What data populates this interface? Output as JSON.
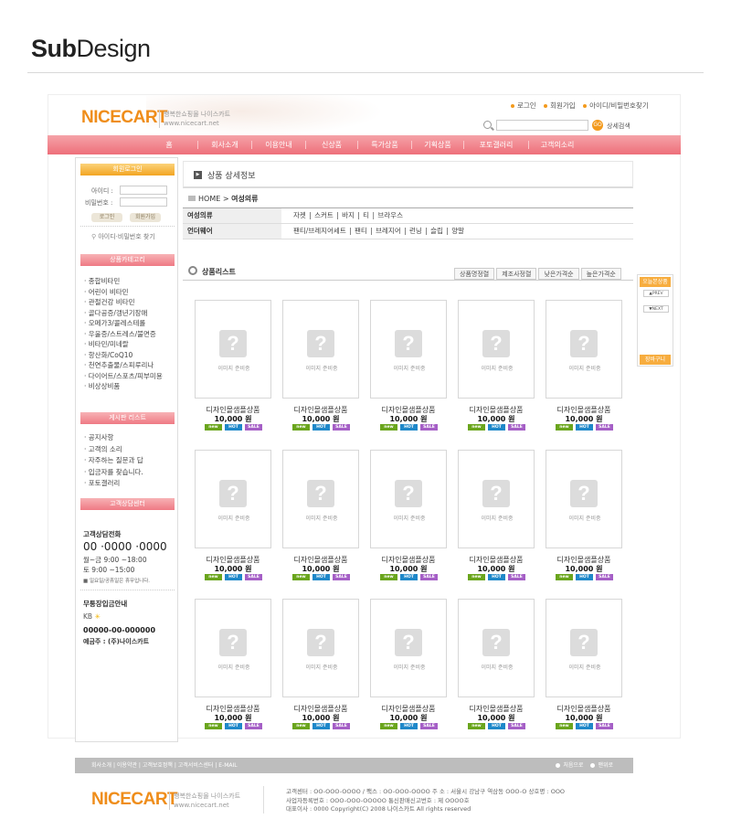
{
  "heading": {
    "bold": "Sub",
    "normal": "Design"
  },
  "header": {
    "logo": "NICECART",
    "logo_tagline": "행복한쇼핑몰 나이스카트",
    "logo_url": "www.nicecart.net",
    "top_links": [
      "로그인",
      "회원가입",
      "아이디/비밀번호찾기"
    ],
    "search_go": "GO",
    "search_detail": "상세검색"
  },
  "nav": [
    "홈",
    "회사소개",
    "이용안내",
    "신상품",
    "특가상품",
    "기획상품",
    "포토갤러리",
    "고객의소리"
  ],
  "sidebar": {
    "login_title": "회원로그인",
    "id_label": "아이디 :",
    "pw_label": "비밀번호 :",
    "login_btn": "로그인",
    "join_btn": "회원가입",
    "find_link": "아이디·비밀번호 찾기",
    "category_title": "상품카테고리",
    "categories": [
      "종합비타민",
      "어린이 비타민",
      "관절건강 비타민",
      "골다공증/갱년기장애",
      "오메가3/콜레스테롤",
      "우울증/스트레스/불면증",
      "비타민/미네랄",
      "항산화/CoQ10",
      "천연추출물/스피루리나",
      "다이어트/스포츠/피부미용",
      "비상상비품"
    ],
    "board_title": "게시판 리스트",
    "boards": [
      "공지사항",
      "고객의 소리",
      "자주하는 질문과 답",
      "입금자를 찾습니다.",
      "포토갤러리"
    ],
    "cs_title": "고객상담센터",
    "cs_label": "고객상담전화",
    "cs_phone": "00 ·0000 ·0000",
    "cs_hours1": "월~금 9:00 ~18:00",
    "cs_hours2": "토 9:00 ~15:00",
    "cs_note": "■ 일요일/공휴일은 휴무입니다.",
    "bank_title": "무통장입금안내",
    "bank_name": "KB",
    "bank_account": "00000-00-000000",
    "bank_holder": "예금주 : (주)나이스카트"
  },
  "main": {
    "title": "상품 상세정보",
    "breadcrumb_home": "HOME",
    "breadcrumb_current": "여성의류",
    "subcats": [
      {
        "name": "여성의류",
        "items": "자켓  |  스커트  |  바지  |  티  |  브라우스"
      },
      {
        "name": "언더웨어",
        "items": "팬티/브레지어세트  |  팬티  |  브레지어  |  런닝  |  슬립  |  양말"
      }
    ],
    "product_list_title": "상품리스트",
    "sort_tabs": [
      "상품명정렬",
      "제조사정렬",
      "낮은가격순",
      "높은가격순"
    ],
    "no_image": "이미지 준비중",
    "products": [
      {
        "name": "디자인몰샘플상품",
        "price": "10,000 원"
      },
      {
        "name": "디자인몰샘플상품",
        "price": "10,000 원"
      },
      {
        "name": "디자인몰샘플상품",
        "price": "10,000 원"
      },
      {
        "name": "디자인몰샘플상품",
        "price": "10,000 원"
      },
      {
        "name": "디자인몰샘플상품",
        "price": "10,000 원"
      },
      {
        "name": "디자인몰샘플상품",
        "price": "10,000 원"
      },
      {
        "name": "디자인몰샘플상품",
        "price": "10,000 원"
      },
      {
        "name": "디자인몰샘플상품",
        "price": "10,000 원"
      },
      {
        "name": "디자인몰샘플상품",
        "price": "10,000 원"
      },
      {
        "name": "디자인몰샘플상품",
        "price": "10,000 원"
      },
      {
        "name": "디자인몰샘플상품",
        "price": "10,000 원"
      },
      {
        "name": "디자인몰샘플상품",
        "price": "10,000 원"
      },
      {
        "name": "디자인몰샘플상품",
        "price": "10,000 원"
      },
      {
        "name": "디자인몰샘플상품",
        "price": "10,000 원"
      },
      {
        "name": "디자인몰샘플상품",
        "price": "10,000 원"
      }
    ],
    "badges": [
      "new",
      "HOT",
      "SALE"
    ]
  },
  "quick_view": {
    "title": "오늘본상품",
    "prev": "▲PREV",
    "next": "▼NEXT",
    "cart": "장바구니"
  },
  "footer": {
    "links": "회사소개  |  이용약관  |  고객보호정책  |  고객서비스센터  |  E-MAIL",
    "right1": "처음으로",
    "right2": "맨위로",
    "logo": "NICECART",
    "logo_tagline": "행복한쇼핑몰 나이스카트",
    "logo_url": "www.nicecart.net",
    "info1": "고객센터 : OO-OOO-OOOO / 팩스 : OO-OOO-OOOO      주 소 : 서울시 강남구 역삼동 OOO-O    상호명 : OOO",
    "info2": "사업자등록번호 : OOO-OOO-OOOOO     통신판매신고번호 : 제 OOOO호",
    "info3": "대표이사 : 0000 Copyright(C) 2008 나이스카트 All rights reserved"
  },
  "colors": {
    "accent_orange": "#ef8d1a",
    "nav_pink": "#ee6f7a"
  }
}
